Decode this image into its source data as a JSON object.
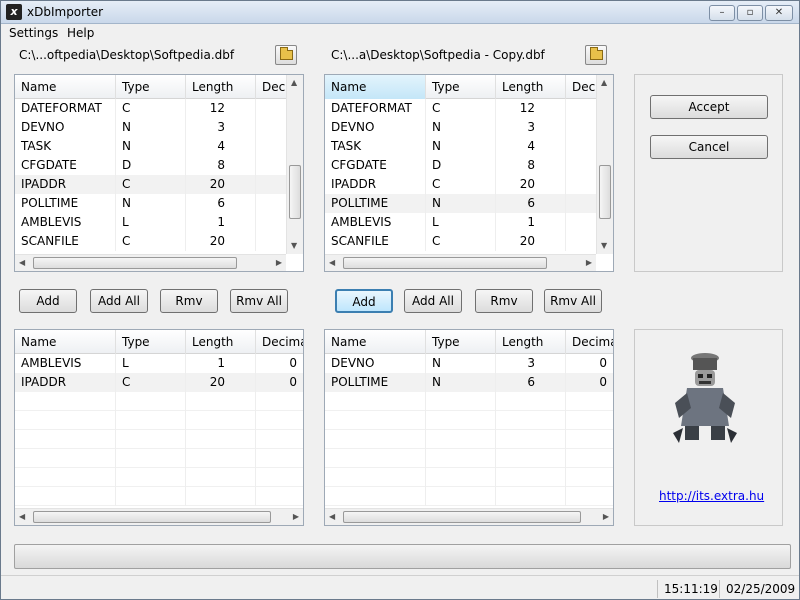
{
  "window": {
    "title": "xDbImporter",
    "icon": "app-logo-icon",
    "controls": [
      "minimize-icon",
      "maximize-icon",
      "close-icon"
    ]
  },
  "menu": {
    "items": [
      "Settings",
      "Help"
    ]
  },
  "files": {
    "left_path": "C:\\...oftpedia\\Desktop\\Softpedia.dbf",
    "right_path": "C:\\...a\\Desktop\\Softpedia - Copy.dbf"
  },
  "top_left": {
    "headers": [
      "Name",
      "Type",
      "Length",
      "Dec"
    ],
    "rows": [
      [
        "DATEFORMAT",
        "C",
        "12",
        ""
      ],
      [
        "DEVNO",
        "N",
        "3",
        ""
      ],
      [
        "TASK",
        "N",
        "4",
        ""
      ],
      [
        "CFGDATE",
        "D",
        "8",
        ""
      ],
      [
        "IPADDR",
        "C",
        "20",
        ""
      ],
      [
        "POLLTIME",
        "N",
        "6",
        ""
      ],
      [
        "AMBLEVIS",
        "L",
        "1",
        ""
      ],
      [
        "SCANFILE",
        "C",
        "20",
        ""
      ]
    ]
  },
  "top_right": {
    "headers": [
      "Name",
      "Type",
      "Length",
      "Dec"
    ],
    "rows": [
      [
        "DATEFORMAT",
        "C",
        "12",
        ""
      ],
      [
        "DEVNO",
        "N",
        "3",
        ""
      ],
      [
        "TASK",
        "N",
        "4",
        ""
      ],
      [
        "CFGDATE",
        "D",
        "8",
        ""
      ],
      [
        "IPADDR",
        "C",
        "20",
        ""
      ],
      [
        "POLLTIME",
        "N",
        "6",
        ""
      ],
      [
        "AMBLEVIS",
        "L",
        "1",
        ""
      ],
      [
        "SCANFILE",
        "C",
        "20",
        ""
      ]
    ]
  },
  "bottom_left": {
    "headers": [
      "Name",
      "Type",
      "Length",
      "Decima"
    ],
    "rows": [
      [
        "AMBLEVIS",
        "L",
        "1",
        "0"
      ],
      [
        "IPADDR",
        "C",
        "20",
        "0"
      ]
    ]
  },
  "bottom_right": {
    "headers": [
      "Name",
      "Type",
      "Length",
      "Decima"
    ],
    "rows": [
      [
        "DEVNO",
        "N",
        "3",
        "0"
      ],
      [
        "POLLTIME",
        "N",
        "6",
        "0"
      ]
    ]
  },
  "buttons": {
    "add": "Add",
    "add_all": "Add All",
    "rmv": "Rmv",
    "rmv_all": "Rmv All",
    "accept": "Accept",
    "cancel": "Cancel"
  },
  "link": "http://its.extra.hu",
  "status": {
    "time": "15:11:19",
    "date": "02/25/2009"
  }
}
